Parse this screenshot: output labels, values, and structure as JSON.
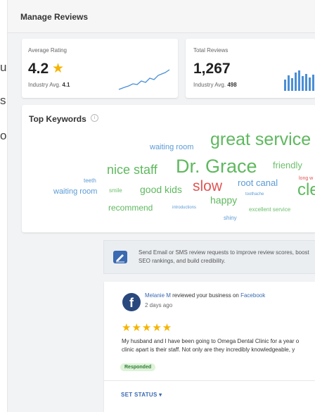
{
  "background_text": [
    "ustry",
    "s",
    "on"
  ],
  "header": {
    "title": "Manage Reviews"
  },
  "average_rating": {
    "label": "Average Rating",
    "value": "4.2",
    "industry_label": "Industry Avg.",
    "industry_value": "4.1"
  },
  "total_reviews": {
    "label": "Total Reviews",
    "value": "1,267",
    "industry_label": "Industry Avg.",
    "industry_value": "498"
  },
  "keywords": {
    "title": "Top Keywords",
    "info_icon": "i",
    "words": [
      {
        "text": "waiting room",
        "color": "#5b9bd5"
      },
      {
        "text": "great service",
        "color": "#5fb85f"
      },
      {
        "text": "nice staff",
        "color": "#5fb85f"
      },
      {
        "text": "Dr. Grace",
        "color": "#5fb85f"
      },
      {
        "text": "friendly",
        "color": "#6dbf6d"
      },
      {
        "text": "teeth",
        "color": "#5b9bd5"
      },
      {
        "text": "waiting room",
        "color": "#5b9bd5"
      },
      {
        "text": "smile",
        "color": "#6dbf6d"
      },
      {
        "text": "good kids",
        "color": "#5fb85f"
      },
      {
        "text": "slow",
        "color": "#e05555"
      },
      {
        "text": "root canal",
        "color": "#5b9bd5"
      },
      {
        "text": "cle",
        "color": "#5fb85f"
      },
      {
        "text": "long w",
        "color": "#e05555"
      },
      {
        "text": "toothache",
        "color": "#5b9bd5"
      },
      {
        "text": "recommend",
        "color": "#5fb85f"
      },
      {
        "text": "introductions",
        "color": "#5b9bd5"
      },
      {
        "text": "happy",
        "color": "#5fb85f"
      },
      {
        "text": "excellent service",
        "color": "#6dbf6d"
      },
      {
        "text": "shiny",
        "color": "#5b9bd5"
      }
    ]
  },
  "banner": {
    "text": "Send Email or SMS review requests to improve review scores, boost SEO rankings, and build credibility."
  },
  "review": {
    "reviewer": "Melanie M",
    "action": "reviewed your business on",
    "platform": "Facebook",
    "date": "2 days ago",
    "stars": "★★★★★",
    "line1": "My husband and I have been going to Omega Dental Clinic for a year o",
    "line2": "clinic apart is their staff. Not only are they incredibly knowledgeable, y",
    "badge": "Responded",
    "set_status": "SET STATUS ▾"
  },
  "colors": {
    "accent": "#3a6ab1",
    "star": "#f5b400",
    "facebook": "#29487d",
    "badge_bg": "#def3d9"
  }
}
